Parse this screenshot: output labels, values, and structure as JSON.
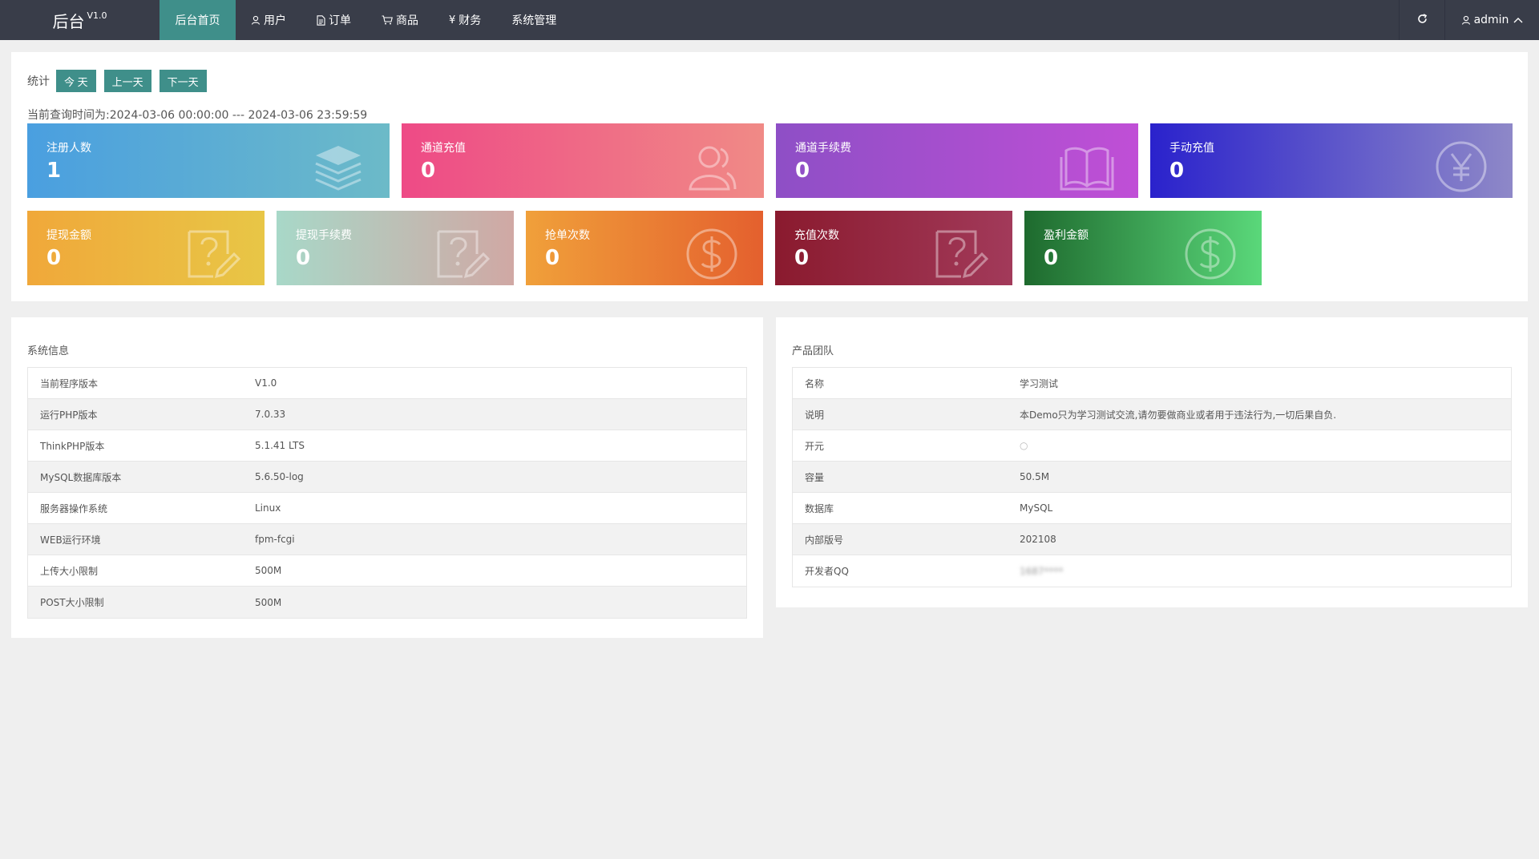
{
  "topbar": {
    "brand": "后台",
    "version": "V1.0",
    "nav": [
      {
        "label": "后台首页",
        "icon": ""
      },
      {
        "label": "用户",
        "icon": "user-icon"
      },
      {
        "label": "订单",
        "icon": "document-icon"
      },
      {
        "label": "商品",
        "icon": "cart-icon"
      },
      {
        "label": "财务",
        "icon": "yen-icon"
      },
      {
        "label": "系统管理",
        "icon": ""
      }
    ],
    "user": "admin"
  },
  "stats": {
    "label": "统计",
    "btn_today": "今 天",
    "btn_prev": "上一天",
    "btn_next": "下一天",
    "query_time": "当前查询时间为:2024-03-06 00:00:00 --- 2024-03-06 23:59:59",
    "cards": [
      {
        "title": "注册人数",
        "value": "1",
        "icon": "layers-icon"
      },
      {
        "title": "通道充值",
        "value": "0",
        "icon": "users-icon"
      },
      {
        "title": "通道手续费",
        "value": "0",
        "icon": "book-icon"
      },
      {
        "title": "手动充值",
        "value": "0",
        "icon": "yen-circle-icon"
      },
      {
        "title": "提现金额",
        "value": "0",
        "icon": "question-edit-icon"
      },
      {
        "title": "提现手续费",
        "value": "0",
        "icon": "question-edit-icon"
      },
      {
        "title": "抢单次数",
        "value": "0",
        "icon": "dollar-circle-icon"
      },
      {
        "title": "充值次数",
        "value": "0",
        "icon": "question-edit-icon"
      },
      {
        "title": "盈利金额",
        "value": "0",
        "icon": "dollar-circle-icon"
      }
    ],
    "colors": {
      "accent": "#3f8f8a",
      "topbar": "#393d49"
    }
  },
  "system_info": {
    "title": "系统信息",
    "rows": [
      {
        "k": "当前程序版本",
        "v": "V1.0"
      },
      {
        "k": "运行PHP版本",
        "v": "7.0.33"
      },
      {
        "k": "ThinkPHP版本",
        "v": "5.1.41 LTS"
      },
      {
        "k": "MySQL数据库版本",
        "v": "5.6.50-log"
      },
      {
        "k": "服务器操作系统",
        "v": "Linux"
      },
      {
        "k": "WEB运行环境",
        "v": "fpm-fcgi"
      },
      {
        "k": "上传大小限制",
        "v": "500M"
      },
      {
        "k": "POST大小限制",
        "v": "500M"
      }
    ]
  },
  "team": {
    "title": "产品团队",
    "rows": [
      {
        "k": "名称",
        "v": "学习测试"
      },
      {
        "k": "说明",
        "v": "本Demo只为学习测试交流,请勿要做商业或者用于违法行为,一切后果自负."
      },
      {
        "k": "开元",
        "v": "○"
      },
      {
        "k": "容量",
        "v": "50.5M"
      },
      {
        "k": "数据库",
        "v": "MySQL"
      },
      {
        "k": "内部版号",
        "v": "202108"
      },
      {
        "k": "开发者QQ",
        "v": "1687****"
      }
    ]
  }
}
